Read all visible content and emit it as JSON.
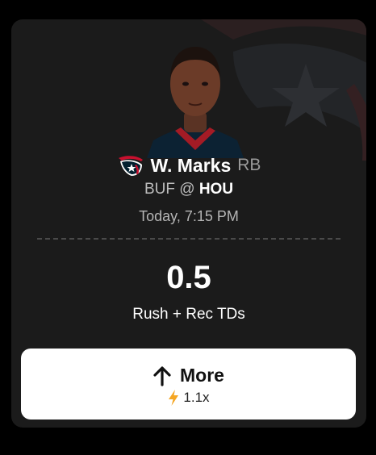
{
  "player": {
    "name": "W. Marks",
    "position": "RB",
    "team_logo_icon": "houston-texans-logo-icon",
    "headshot_icon": "player-headshot"
  },
  "game": {
    "away": "BUF",
    "separator": "@",
    "home": "HOU",
    "time": "Today, 7:15 PM"
  },
  "projection": {
    "line": "0.5",
    "stat": "Rush + Rec TDs"
  },
  "pick_button": {
    "label": "More",
    "icon": "arrow-up-icon",
    "multiplier": "1.1x",
    "multiplier_icon": "lightning-bolt-icon"
  },
  "colors": {
    "background": "#000000",
    "card": "#1b1b1b",
    "texans_red": "#c8102e",
    "texans_navy": "#03202f",
    "bolt": "#f5a623"
  }
}
